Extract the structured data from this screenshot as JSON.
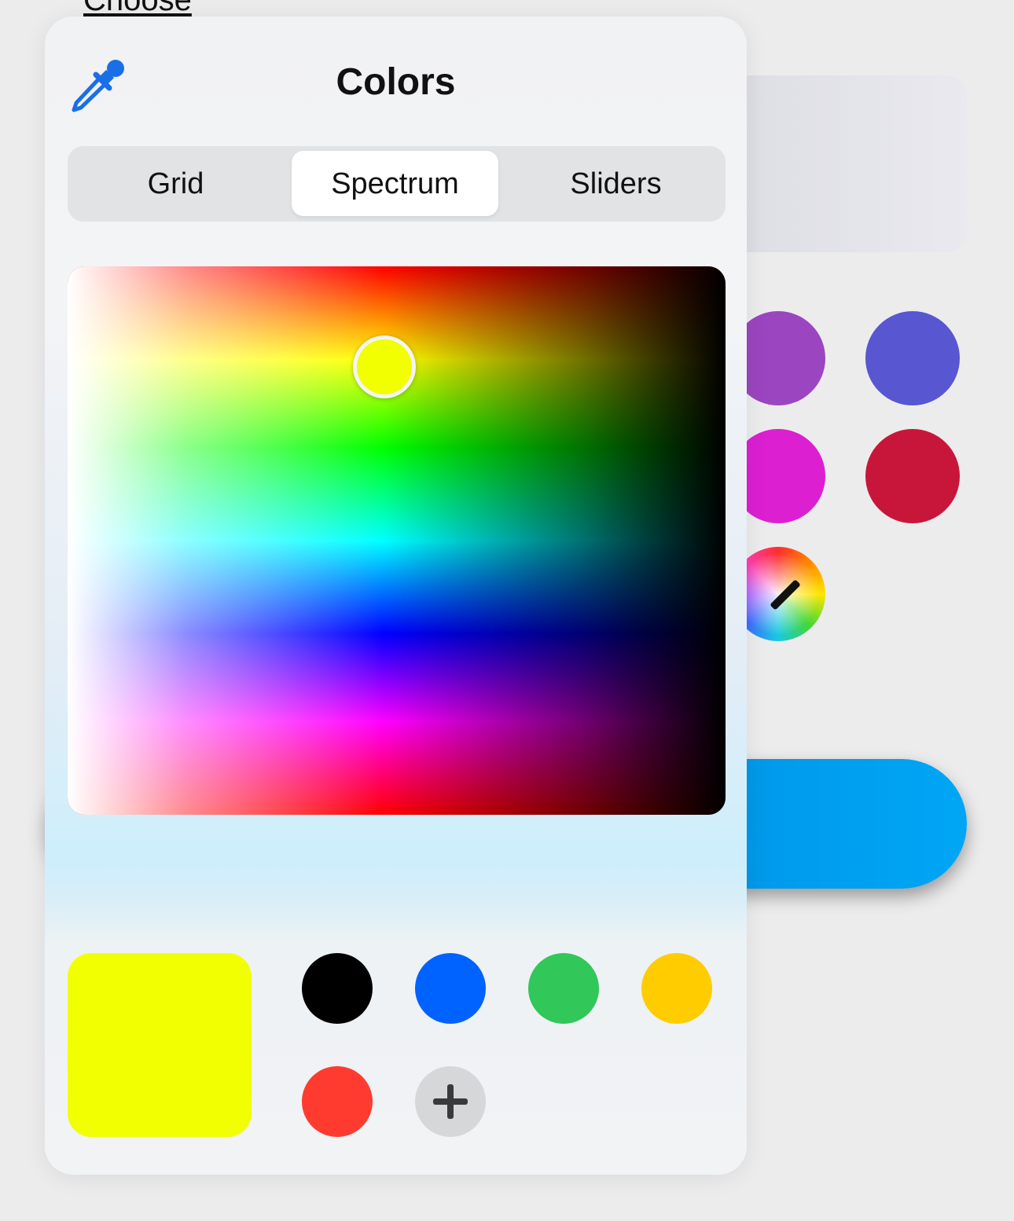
{
  "background": {
    "link_label": "Choose",
    "swatches": [
      {
        "name": "purple",
        "color": "#9b45c0"
      },
      {
        "name": "indigo",
        "color": "#5856d0"
      },
      {
        "name": "magenta",
        "color": "#dc1fd1"
      },
      {
        "name": "crimson",
        "color": "#c8163a"
      }
    ]
  },
  "popover": {
    "title": "Colors",
    "tabs": [
      {
        "label": "Grid",
        "active": false
      },
      {
        "label": "Spectrum",
        "active": true
      },
      {
        "label": "Sliders",
        "active": false
      }
    ],
    "selected_color": "#f2ff00",
    "saved_colors": [
      {
        "name": "black",
        "color": "#000000"
      },
      {
        "name": "blue",
        "color": "#0062ff"
      },
      {
        "name": "green",
        "color": "#31c759"
      },
      {
        "name": "yellow",
        "color": "#ffcc00"
      },
      {
        "name": "red",
        "color": "#ff3b30"
      }
    ],
    "icons": {
      "eyedropper": "eyedropper-icon",
      "add": "plus-icon"
    }
  }
}
